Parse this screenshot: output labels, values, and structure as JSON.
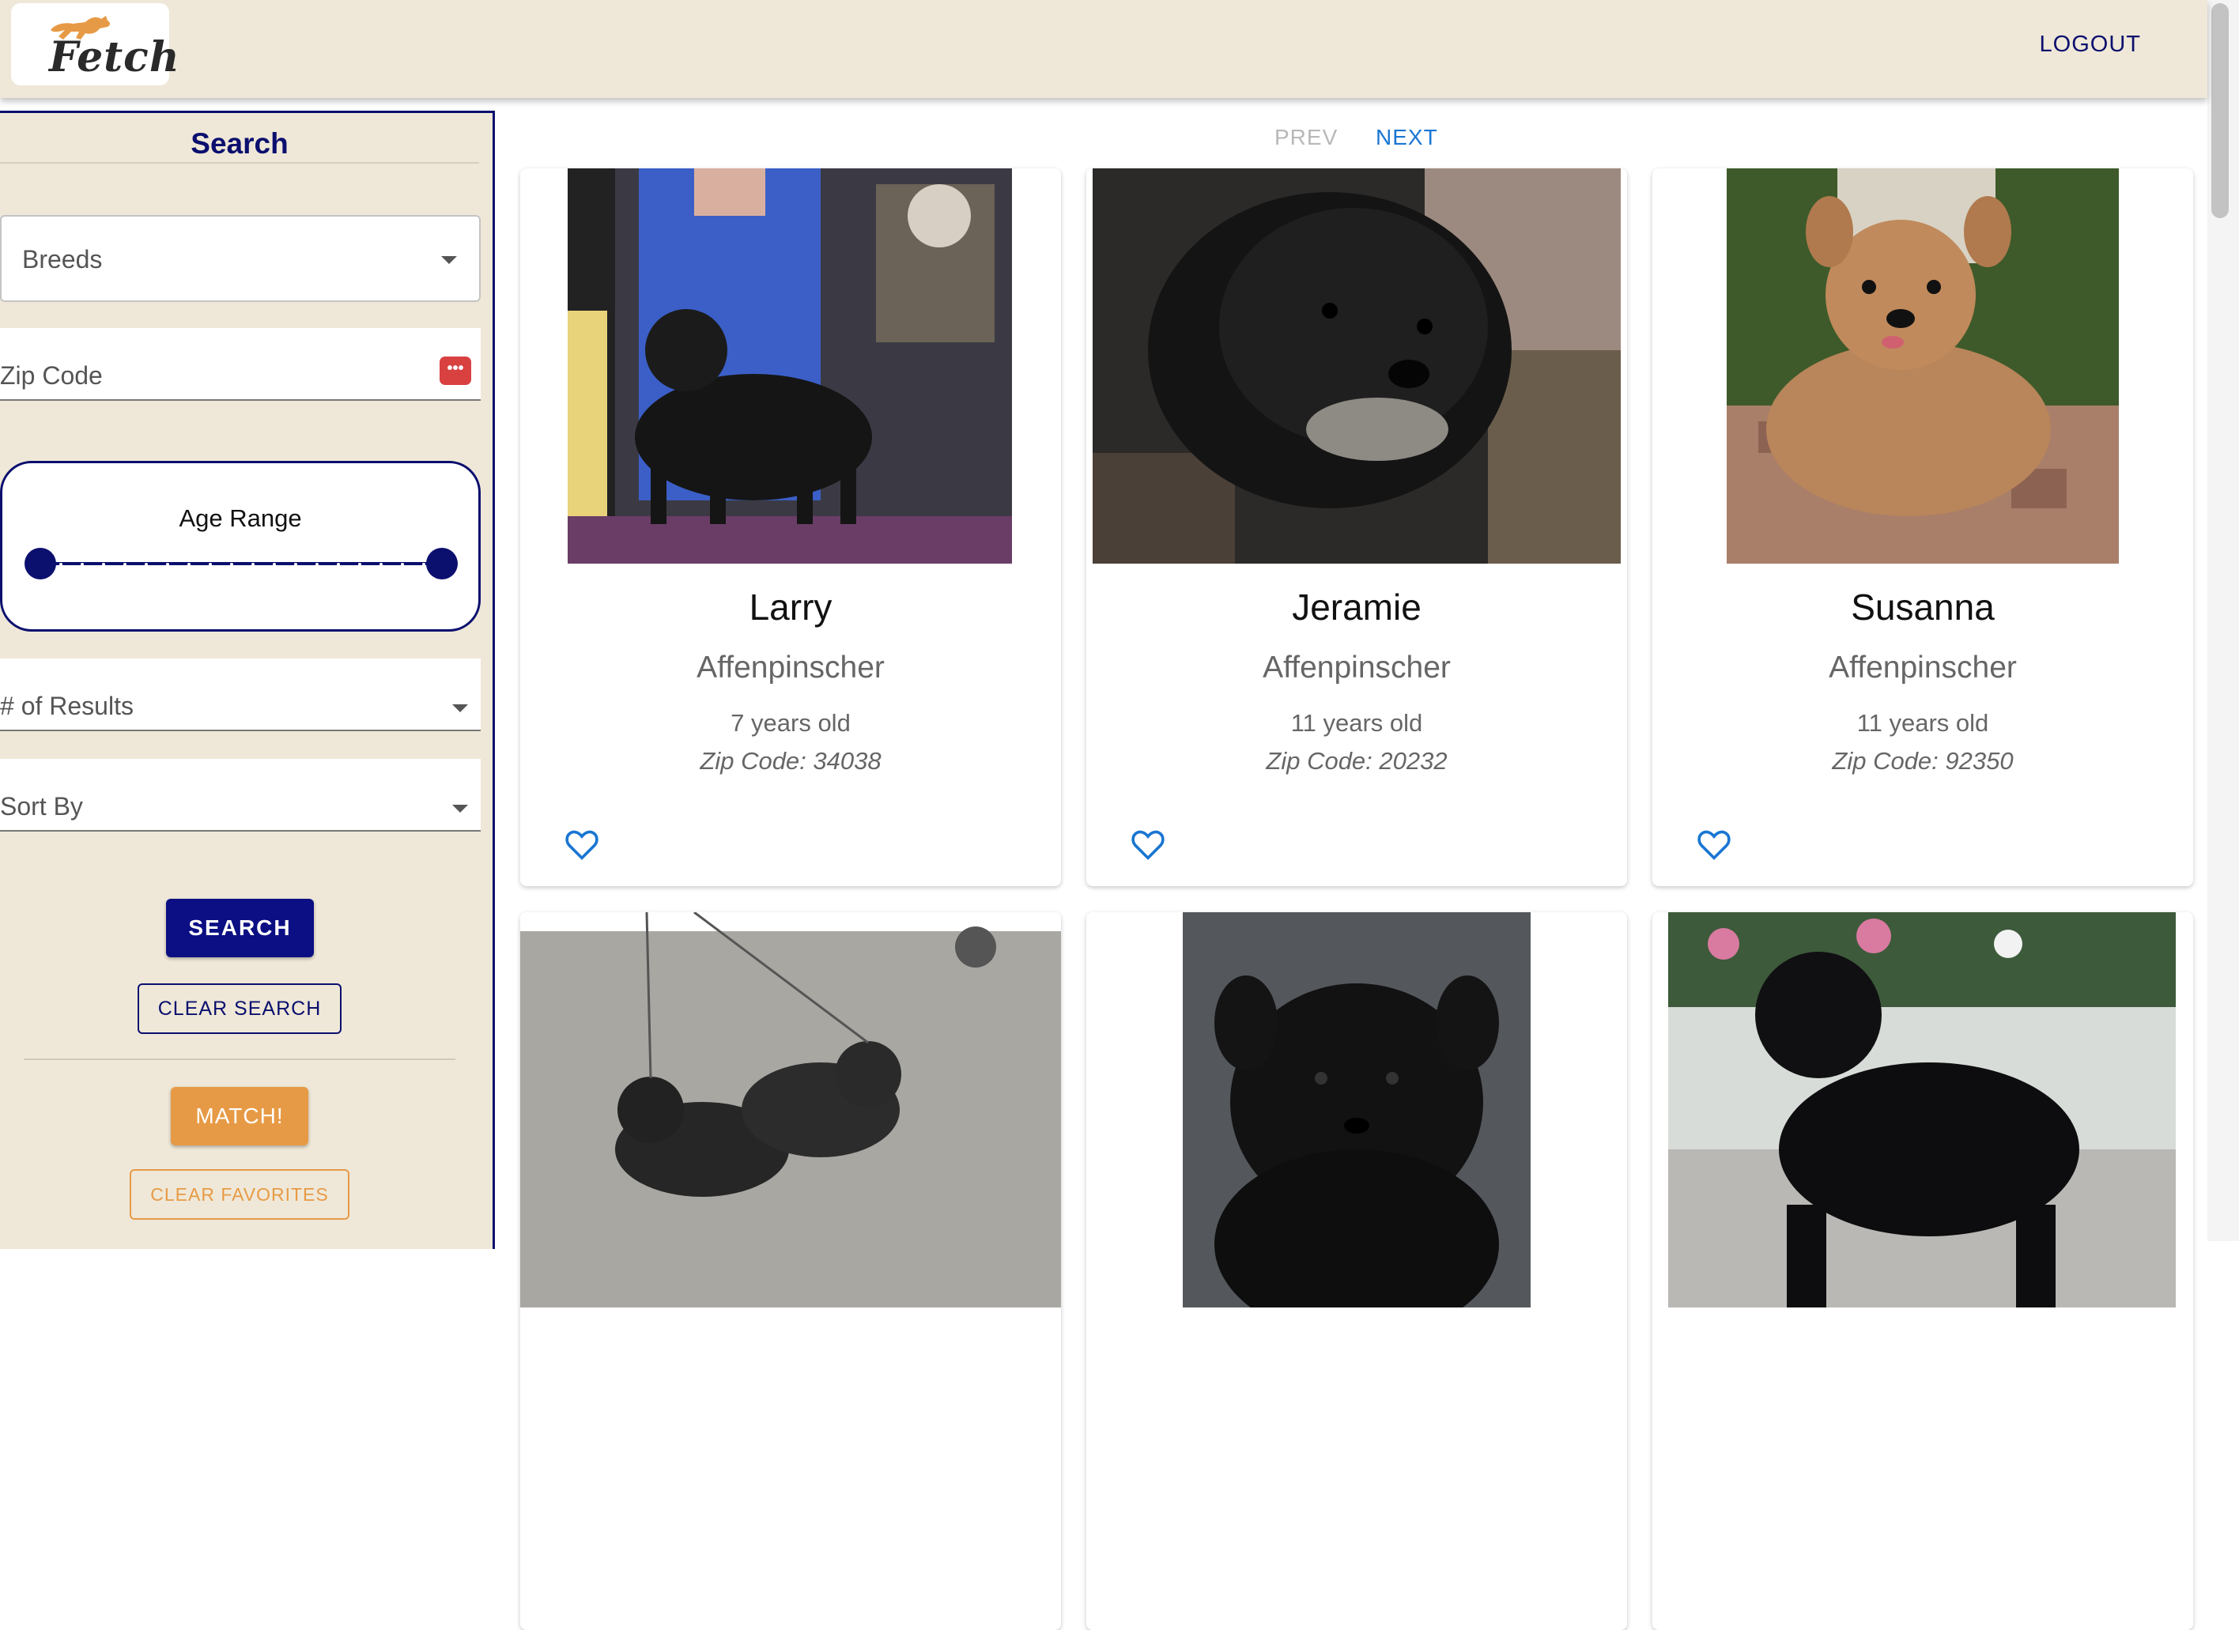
{
  "header": {
    "logo_text": "Fetch",
    "logout_label": "LOGOUT"
  },
  "sidebar": {
    "title": "Search",
    "breeds_label": "Breeds",
    "zip_label": "Zip Code",
    "age_label": "Age Range",
    "results_label": "# of Results",
    "sort_label": "Sort By",
    "search_button": "SEARCH",
    "clear_search_button": "CLEAR SEARCH",
    "match_button": "MATCH!",
    "clear_favorites_button": "CLEAR FAVORITES"
  },
  "pager": {
    "prev_label": "PREV",
    "next_label": "NEXT"
  },
  "colors": {
    "brand_navy": "#0b0f6e",
    "header_bg": "#efe8d8",
    "accent_orange": "#e79a45",
    "link_blue": "#1976d2"
  },
  "dogs": [
    {
      "name": "Larry",
      "breed": "Affenpinscher",
      "age": "7 years old",
      "zip": "Zip Code: 34038",
      "favorite_icon": "heart-outline-icon"
    },
    {
      "name": "Jeramie",
      "breed": "Affenpinscher",
      "age": "11 years old",
      "zip": "Zip Code: 20232",
      "favorite_icon": "heart-outline-icon"
    },
    {
      "name": "Susanna",
      "breed": "Affenpinscher",
      "age": "11 years old",
      "zip": "Zip Code: 92350",
      "favorite_icon": "heart-outline-icon"
    },
    {
      "name": "",
      "breed": "",
      "age": "",
      "zip": "",
      "favorite_icon": ""
    },
    {
      "name": "",
      "breed": "",
      "age": "",
      "zip": "",
      "favorite_icon": ""
    },
    {
      "name": "",
      "breed": "",
      "age": "",
      "zip": "",
      "favorite_icon": ""
    }
  ]
}
